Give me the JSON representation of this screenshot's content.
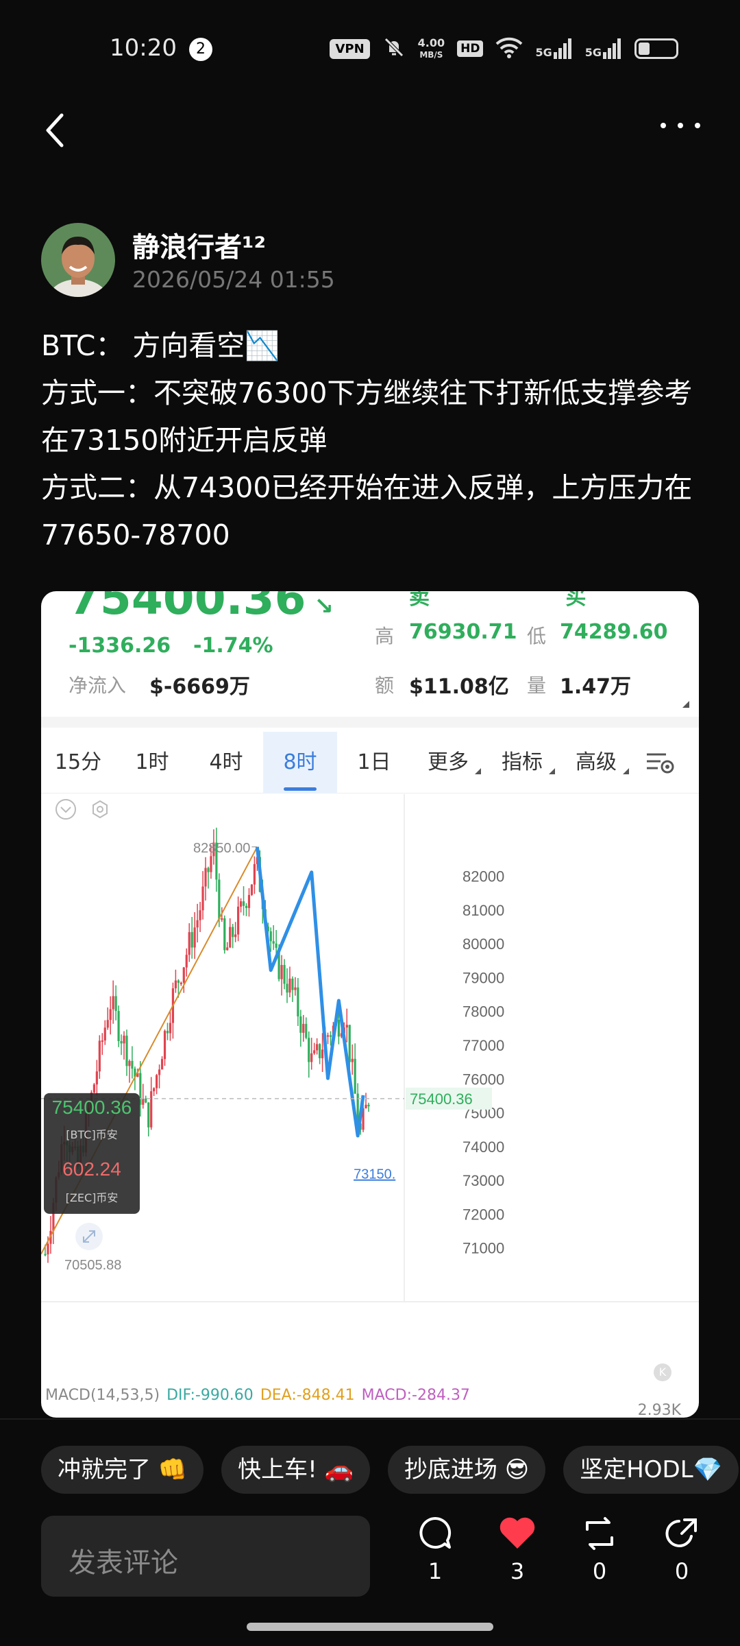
{
  "status_bar": {
    "time": "10:20",
    "notification_count": "2",
    "vpn": "VPN",
    "speed_value": "4.00",
    "speed_unit": "MB/S",
    "hd": "HD",
    "net1": "5G",
    "net2": "5G",
    "battery_level": 0.3
  },
  "post": {
    "author": "静浪行者¹²",
    "time": "2026/05/24 01:55",
    "lines": [
      "BTC： 方向看空📉",
      "方式一：不突破76300下方继续往下打新低支撑参考在73150附近开启反弹",
      "方式二：从74300已经开始在进入反弹，上方压力在77650-78700"
    ]
  },
  "ticker": {
    "price": "75400.36",
    "change": "-1336.26",
    "change_pct": "-1.74%",
    "inflow_label": "净流入",
    "inflow_value": "$-6669万",
    "high_label": "高",
    "high_value": "76930.71",
    "low_label": "低",
    "low_value": "74289.60",
    "amount_label": "额",
    "amount_value": "$11.08亿",
    "volume_label": "量",
    "volume_value": "1.47万"
  },
  "tabs": [
    "15分",
    "1时",
    "4时",
    "8时",
    "1日",
    "更多",
    "指标",
    "高级"
  ],
  "active_tab": "8时",
  "chart_data": {
    "type": "candlestick",
    "y_ticks": [
      82000,
      81000,
      80000,
      79000,
      78000,
      77000,
      76000,
      75000,
      74000,
      73000,
      72000,
      71000
    ],
    "ylim": [
      70200,
      83800
    ],
    "high_marker": "82850.00",
    "low_marker": "70505.88",
    "current_price_label": "75400.36",
    "support_label": "73150.",
    "overlay": {
      "btc_price": "75400.36",
      "btc_name": "[BTC]币安",
      "zec_price": "602.24",
      "zec_name": "[ZEC]币安"
    },
    "blue_path_prices": [
      82850,
      79200,
      82100,
      76000,
      78300,
      74300,
      75500
    ],
    "orange_trend_from": 70800,
    "orange_trend_to": 82850
  },
  "macd": {
    "label": "MACD(14,53,5)",
    "dif": "DIF:-990.60",
    "dea": "DEA:-848.41",
    "macd": "MACD:-284.37",
    "vol_tick": "2.93K"
  },
  "chips": [
    "冲就完了 👊",
    "快上车! 🚗",
    "抄底进场 😎",
    "坚定HODL💎"
  ],
  "comment_placeholder": "发表评论",
  "actions": {
    "comments": "1",
    "likes": "3",
    "reposts": "0",
    "shares": "0"
  },
  "colors": {
    "up": "#e0434f",
    "down": "#2fae5c",
    "blue_line": "#2f8fe6",
    "orange_line": "#d98b2b",
    "accent": "#3b7ddd"
  }
}
